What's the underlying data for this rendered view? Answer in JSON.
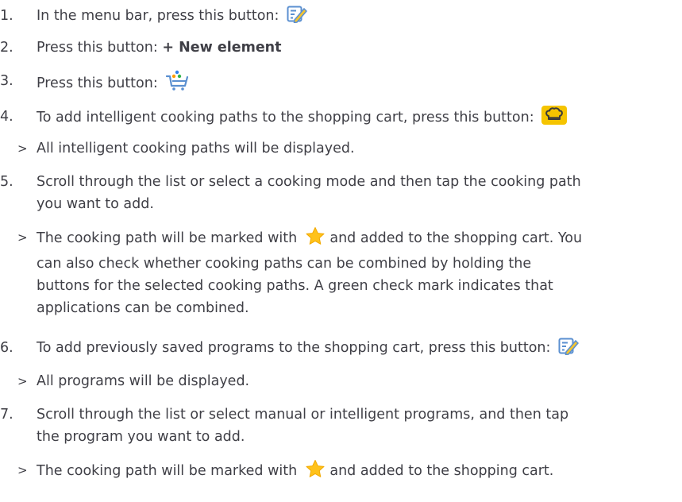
{
  "colors": {
    "text": "#3f3f46",
    "edit_icon_blue": "#5a8fd0",
    "edit_icon_yellow": "#f4c430",
    "cart_dots": [
      "#ff9d00",
      "#33b34a",
      "#2f80ed"
    ],
    "chef_badge": "#f5c400",
    "star": "#ffc21a"
  },
  "steps": [
    {
      "marker": "1.",
      "text_a": "In the menu bar, press this button:",
      "icon": "edit-icon"
    },
    {
      "marker": "2.",
      "text_a": "Press this button:",
      "text_bold": "+ New element"
    },
    {
      "marker": "3.",
      "text_a": "Press this button:",
      "icon": "shopping-cart-icon"
    },
    {
      "marker": "4.",
      "text_a": "To add intelligent cooking paths to the shopping cart, press this button:",
      "icon": "chef-hat-icon"
    },
    {
      "marker": ">",
      "text_a": "All intelligent cooking paths will be displayed."
    },
    {
      "marker": "5.",
      "text_a": "Scroll through the list or select a cooking mode and then tap the cooking path",
      "text_b": "you want to add."
    },
    {
      "marker": ">",
      "text_a": "The cooking path will be marked with",
      "icon": "star-icon",
      "text_after_icon": "and added to the shopping cart. You",
      "text_b": "can also check whether cooking paths can be combined by holding the",
      "text_c": "buttons for the selected cooking paths. A green check mark indicates that",
      "text_d": "applications can be combined."
    },
    {
      "marker": "6.",
      "text_a": "To add previously saved programs to the shopping cart, press this button:",
      "icon": "edit-icon"
    },
    {
      "marker": ">",
      "text_a": "All programs will be displayed."
    },
    {
      "marker": "7.",
      "text_a": "Scroll through the list or select manual or intelligent programs, and then tap",
      "text_b": "the program you want to add."
    },
    {
      "marker": ">",
      "text_a": "The cooking path will be marked with",
      "icon": "star-icon",
      "text_after_icon": "and added to the shopping cart."
    }
  ]
}
